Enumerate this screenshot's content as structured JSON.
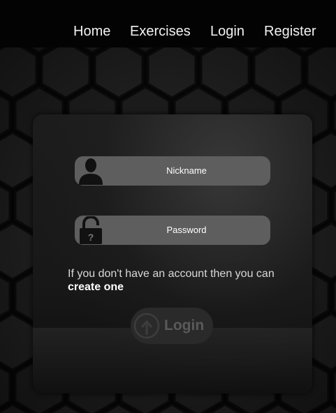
{
  "nav": {
    "items": [
      {
        "label": "Home"
      },
      {
        "label": "Exercises"
      },
      {
        "label": "Login"
      },
      {
        "label": "Register"
      }
    ]
  },
  "form": {
    "nickname": {
      "placeholder": "Nickname",
      "icon": "user-silhouette-icon"
    },
    "password": {
      "placeholder": "Password",
      "icon": "padlock-icon"
    },
    "info_text": "If you don't have an account then you can",
    "create_link": "create one",
    "login_button": {
      "label": "Login",
      "icon": "upload-arrow-icon"
    }
  },
  "colors": {
    "nav_bg": "#030303",
    "field_bg": "#5e5e5e",
    "button_bg": "#2a2a2a",
    "button_text": "#5a5a5a"
  }
}
